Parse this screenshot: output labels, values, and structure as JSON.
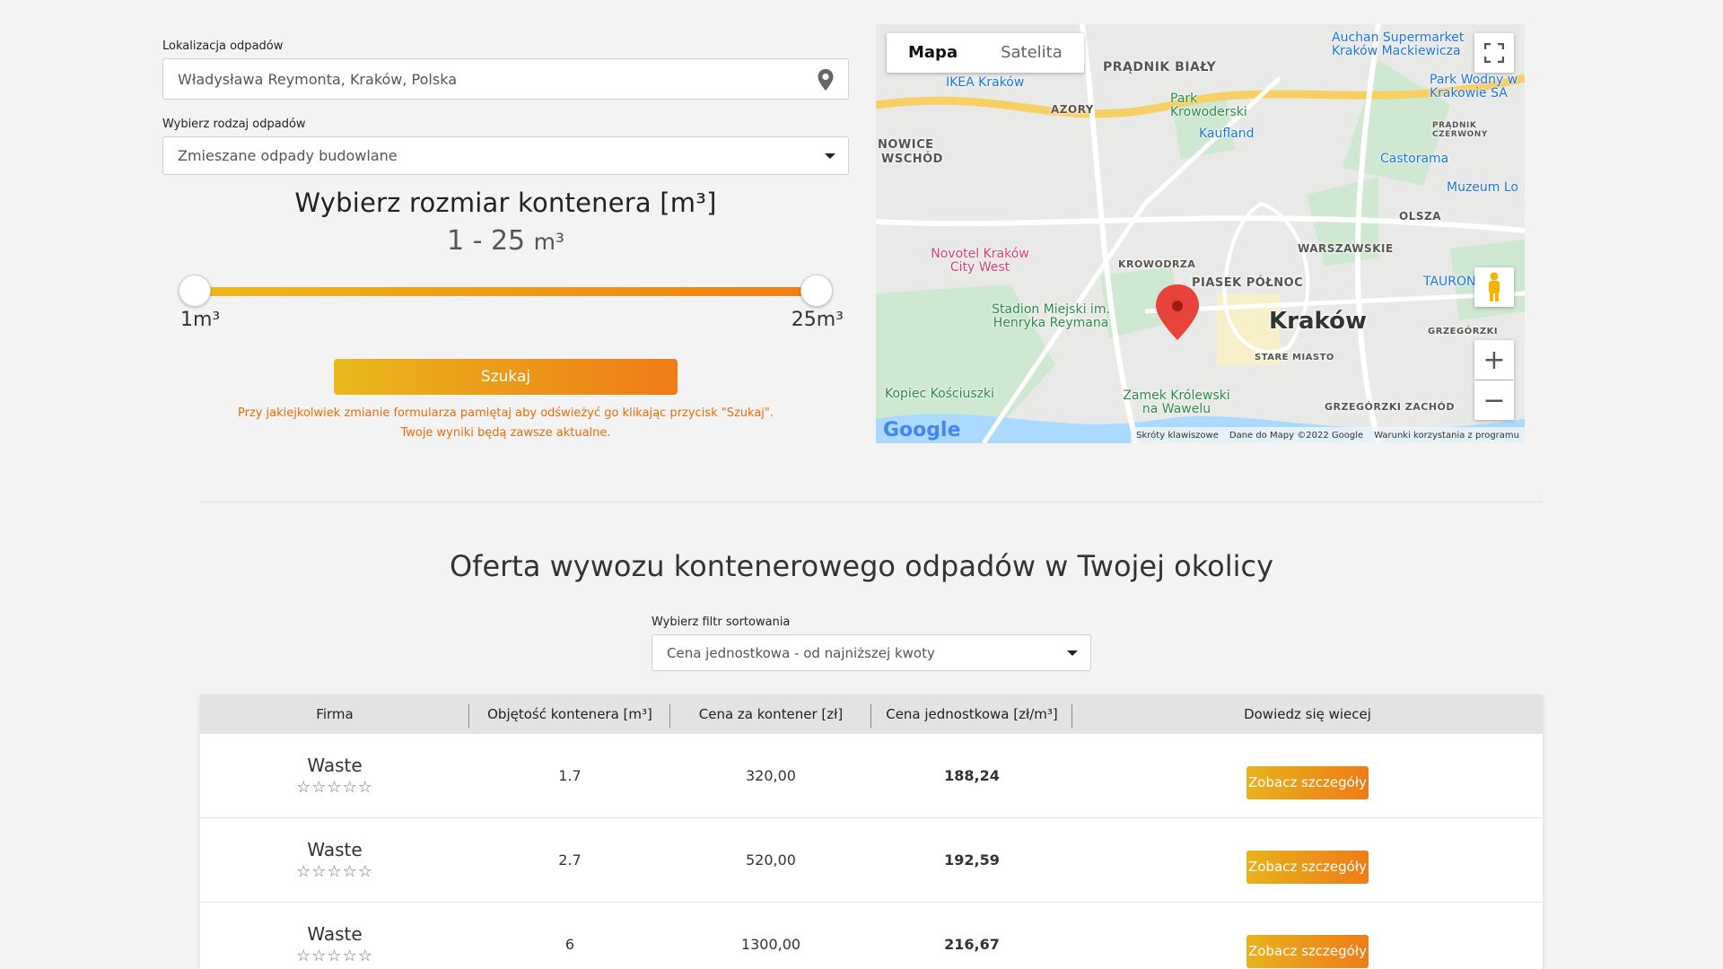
{
  "form": {
    "location_label": "Lokalizacja odpadów",
    "location_value": "Władysława Reymonta, Kraków, Polska",
    "waste_label": "Wybierz rodzaj odpadów",
    "waste_value": "Zmieszane odpady budowlane",
    "size_title": "Wybierz rozmiar kontenera [m³]",
    "size_range": "1 - 25",
    "size_unit": "m³",
    "slider_min_label": "1m³",
    "slider_max_label": "25m³",
    "slider_min": 1,
    "slider_max": 25,
    "search_label": "Szukaj",
    "notice_line1": "Przy jakiejkolwiek zmianie formularza pamiętaj aby odświeżyć go klikając przycisk \"Szukaj\".",
    "notice_line2": "Twoje wyniki będą zawsze aktualne."
  },
  "map": {
    "tab_map": "Mapa",
    "tab_satellite": "Satelita",
    "city": "Kraków",
    "places": [
      "PRĄDNIK BIAŁY",
      "AZORY",
      "NOWICE",
      "WSCHÓD",
      "KROWODRZA",
      "PIASEK PÓŁNOC",
      "WARSZAWSKIE",
      "OLSZA",
      "STARE MIASTO",
      "GRZEGÓRZKI",
      "GRZEGÓRZKI ZACHÓD",
      "PRĄDNIK CZERWONY"
    ],
    "pois": [
      "Auchan Supermarket Kraków Mackiewicza",
      "IKEA Kraków",
      "Park Krowoderski",
      "Park Wodny w Krakowie SA",
      "Castorama",
      "Muzeum Lo",
      "Novotel Kraków City West",
      "Stadion Miejski im. Henryka Reymana",
      "Kopiec Kościuszki",
      "Zamek Królewski na Wawelu",
      "TAURON",
      "Kaufland"
    ],
    "logo": "Google",
    "footer_shortcuts": "Skróty klawiszowe",
    "footer_data": "Dane do Mapy ©2022 Google",
    "footer_terms": "Warunki korzystania z programu"
  },
  "offers": {
    "title": "Oferta wywozu kontenerowego odpadów w Twojej okolicy",
    "sort_label": "Wybierz filtr sortowania",
    "sort_value": "Cena jednostkowa - od najniższej kwoty",
    "headers": [
      "Firma",
      "Objętość kontenera [m³]",
      "Cena za kontener [zł]",
      "Cena jednostkowa [zł/m³]",
      "Dowiedz się wiecej"
    ],
    "rows": [
      {
        "company": "Waste",
        "stars": "☆☆☆☆☆",
        "volume": "1.7",
        "price": "320,00",
        "unit_price": "188,24",
        "button": "Zobacz szczegóły"
      },
      {
        "company": "Waste",
        "stars": "☆☆☆☆☆",
        "volume": "2.7",
        "price": "520,00",
        "unit_price": "192,59",
        "button": "Zobacz szczegóły"
      },
      {
        "company": "Waste",
        "stars": "☆☆☆☆☆",
        "volume": "6",
        "price": "1300,00",
        "unit_price": "216,67",
        "button": "Zobacz szczegóły"
      }
    ]
  },
  "colors": {
    "accent_start": "#e8b81d",
    "accent_end": "#ef7b17",
    "notice": "#e86c0a"
  }
}
